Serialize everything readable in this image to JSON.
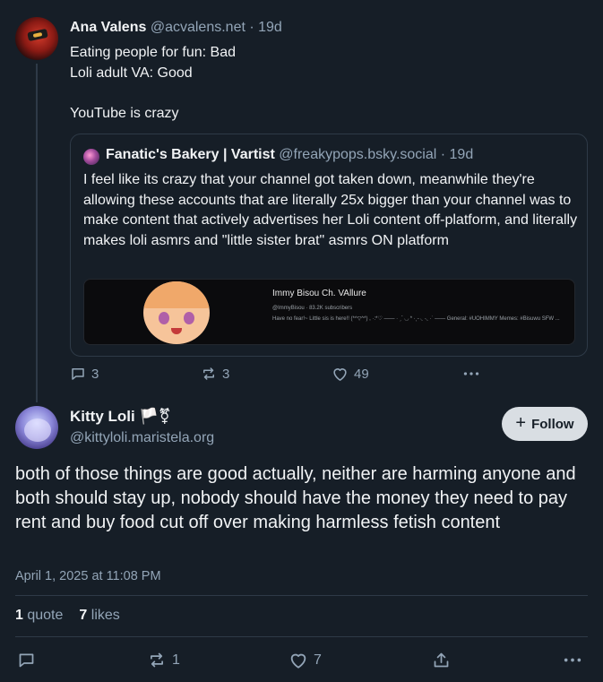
{
  "parent_post": {
    "author_name": "Ana Valens",
    "author_handle": "@acvalens.net",
    "age": "· 19d",
    "lines": [
      "Eating people for fun: Bad",
      "Loli adult VA: Good",
      "",
      "YouTube is crazy"
    ],
    "quote": {
      "author_name": "Fanatic's Bakery | Vartist",
      "author_handle": "@freakypops.bsky.social",
      "age": "· 19d",
      "text": "I feel like its crazy that your channel got taken down, meanwhile they're allowing these accounts that are literally 25x bigger than your channel was to make content that actively advertises her Loli content off-platform, and literally makes loli asmrs and \"little sister brat\" asmrs ON platform",
      "embed": {
        "title": "Immy Bisou Ch. VAllure",
        "meta": "@ImmyBisou · 83.2K subscribers",
        "description": "Have no fear!~ Little sis is here!! (*^▽^*) , ·:*♡ —— · ˏˋ ◟◞ * ·ˎ˗ ◟ ·◟ ·˙ —— General: #UOHIMMY Memes: #Bisuwu SFW ..."
      },
      "emoji_icon": "avatar-icon"
    },
    "actions": {
      "replies": "3",
      "reposts": "3",
      "likes": "49"
    }
  },
  "main_post": {
    "author_name": "Kitty Loli 🏳️⚧",
    "author_handle": "@kittyloli.maristela.org",
    "follow_label": "Follow",
    "text": "both of those things are good actually, neither are harming anyone and both should stay up, nobody should have the money they need to pay rent and buy food cut off over making harmless fetish content",
    "timestamp": "April 1, 2025 at 11:08 PM",
    "stats": {
      "quotes_count": "1",
      "quotes_label": "quote",
      "likes_count": "7",
      "likes_label": "likes"
    },
    "actions": {
      "reposts": "1",
      "likes": "7"
    }
  },
  "colors": {
    "background": "#161e27",
    "text_primary": "#f1f3f5",
    "text_secondary": "#93a5b7",
    "border": "#2e3a47",
    "follow_button_bg": "#d9dee3"
  }
}
